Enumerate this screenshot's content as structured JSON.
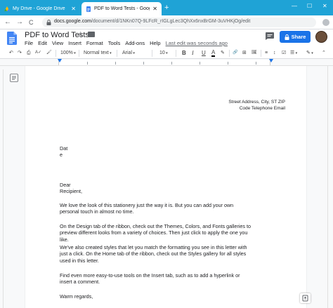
{
  "browser": {
    "tabs": [
      {
        "title": "My Drive - Google Drive",
        "active": false
      },
      {
        "title": "PDF to Word Tests - Google Docs",
        "active": true
      }
    ],
    "new_tab": "+",
    "window_controls": {
      "minimize": "—",
      "maximize": "☐",
      "close": "✕"
    },
    "nav": {
      "back": "←",
      "forward": "→",
      "reload": "C"
    },
    "url_host": "docs.google.com",
    "url_path": "/document/d/1NKn07Q-9LFcR_rIGLgLec3QhXx6nxBrGM-3uVHKjOg/edit",
    "accent": "#1fa3d6"
  },
  "docs": {
    "title": "PDF to Word Tests",
    "star": "☆",
    "menu": [
      "File",
      "Edit",
      "View",
      "Insert",
      "Format",
      "Tools",
      "Add-ons",
      "Help"
    ],
    "last_edit": "Last edit was seconds ago",
    "share_label": "Share",
    "brand_color": "#1a73e8"
  },
  "toolbar": {
    "undo": "↶",
    "redo": "↷",
    "print": "⎙",
    "spell": "A✓",
    "paint": "🖌",
    "zoom": "100%",
    "style": "Normal text",
    "font": "Arial",
    "minus": "—",
    "size": "10",
    "plus": "+",
    "bold": "B",
    "italic": "I",
    "underline": "U",
    "text_color": "A",
    "highlight": "✎",
    "link": "🔗",
    "comment": "⊞",
    "image": "🖼",
    "align": "≡",
    "line_spacing": "↕",
    "checklist": "☑",
    "bullets": "☰",
    "edit_mode": "✎",
    "collapse": "⌃"
  },
  "letter": {
    "sender_line1": "Street Address, City, ST ZIP",
    "sender_line2": "Code Telephone Email",
    "date_line1": "Dat",
    "date_line2": "e",
    "greeting_line1": "Dear",
    "greeting_line2": "Recipient,",
    "p1": "We love the look of this stationery just the way it is. But you can add your own personal touch in almost no time.",
    "p2": "On the Design tab of the ribbon, check out the Themes, Colors, and Fonts galleries to preview different looks from a variety of choices. Then just click to apply the one you like.",
    "p3": "We've also created styles that let you match the formatting you see in this letter with just a click. On the Home tab of the ribbon, check out the Styles gallery for all styles used in this letter.",
    "p4": "Find even more easy-to-use tools on the Insert tab, such as to add a hyperlink or insert a comment.",
    "closing": "Warm regards,"
  }
}
